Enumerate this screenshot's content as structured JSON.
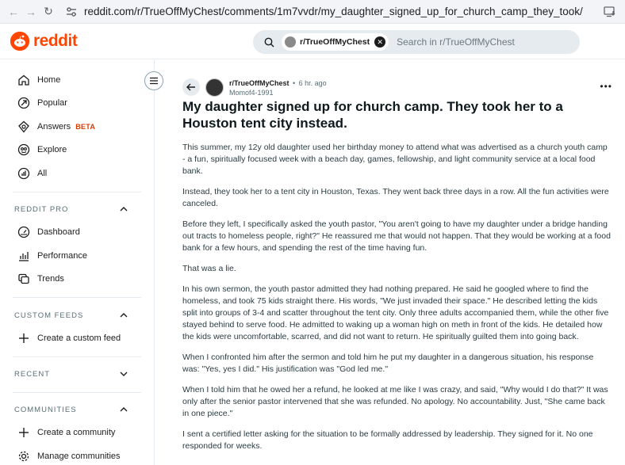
{
  "browser": {
    "url_domain": "reddit.com",
    "url_path": "/r/TrueOffMyChest/comments/1m7vvdr/my_daughter_signed_up_for_church_camp_they_took/"
  },
  "header": {
    "logo_text": "reddit",
    "search_chip": "r/TrueOffMyChest",
    "search_placeholder": "Search in r/TrueOffMyChest"
  },
  "sidebar": {
    "nav": [
      {
        "label": "Home",
        "icon": "home-icon"
      },
      {
        "label": "Popular",
        "icon": "popular-icon"
      },
      {
        "label": "Answers",
        "icon": "answers-icon",
        "badge": "BETA"
      },
      {
        "label": "Explore",
        "icon": "explore-icon"
      },
      {
        "label": "All",
        "icon": "all-icon"
      }
    ],
    "reddit_pro": {
      "title": "REDDIT PRO",
      "items": [
        {
          "label": "Dashboard",
          "icon": "dashboard-icon"
        },
        {
          "label": "Performance",
          "icon": "performance-icon"
        },
        {
          "label": "Trends",
          "icon": "trends-icon"
        }
      ]
    },
    "custom_feeds": {
      "title": "CUSTOM FEEDS",
      "items": [
        {
          "label": "Create a custom feed",
          "icon": "plus-icon"
        }
      ]
    },
    "recent": {
      "title": "RECENT"
    },
    "communities": {
      "title": "COMMUNITIES",
      "items": [
        {
          "label": "Create a community",
          "icon": "plus-icon"
        },
        {
          "label": "Manage communities",
          "icon": "gear-icon"
        }
      ]
    }
  },
  "post": {
    "subreddit": "r/TrueOffMyChest",
    "separator": "•",
    "time": "6 hr. ago",
    "author": "Momof4-1991",
    "title": "My daughter signed up for church camp. They took her to a Houston tent city instead.",
    "paragraphs": [
      "This summer, my 12y old daughter used her birthday money to attend what was advertised as a church youth camp - a fun, spiritually focused week with a beach day, games, fellowship, and light community service at a local food bank.",
      "Instead, they took her to a tent city in Houston, Texas. They went back three days in a row. All the fun activities were canceled.",
      "Before they left, I specifically asked the youth pastor, \"You aren't going to have my daughter under a bridge handing out tracts to homeless people, right?\" He reassured me that would not happen. That they would be working at a food bank for a few hours, and spending the rest of the time having fun.",
      "That was a lie.",
      "In his own sermon, the youth pastor admitted they had nothing prepared. He said he googled where to find the homeless, and took 75 kids straight there. His words, \"We just invaded their space.\" He described letting the kids split into groups of 3-4 and scatter throughout the tent city. Only three adults accompanied them, while the other five stayed behind to serve food. He admitted to waking up a woman high on meth in front of the kids. He detailed how the kids were uncomfortable, scarred, and did not want to return. He spiritually guilted them into going back.",
      "When I confronted him after the sermon and told him he put my daughter in a dangerous situation, his response was: \"Yes, yes I did.\" His justification was \"God led me.\"",
      "When I told him that he owed her a refund, he looked at me like I was crazy, and said, \"Why would I do that?\" It was only after the senior pastor intervened that she was refunded. No apology. No accountability. Just, \"She came back in one piece.\"",
      "I sent a certified letter asking for the situation to be formally addressed by leadership. They signed for it. No one responded for weeks."
    ]
  }
}
